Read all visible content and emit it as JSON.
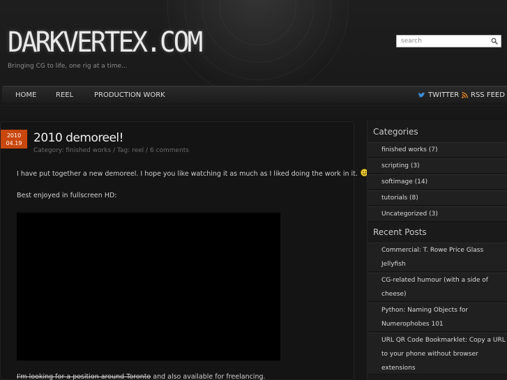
{
  "site": {
    "logo": "DARKVERTEX.COM",
    "tagline": "Bringing CG to life, one rig at a time..."
  },
  "search": {
    "placeholder": "search"
  },
  "nav": {
    "items": [
      "HOME",
      "REEL",
      "PRODUCTION WORK"
    ],
    "twitter": "TWITTER",
    "rss": "RSS FEED"
  },
  "post": {
    "date_year": "2010",
    "date_day": "04.19",
    "title": "2010 demoreel!",
    "meta_prefix": "Category: ",
    "category": "finished works",
    "meta_sep1": " / Tag: ",
    "tag": "reel",
    "meta_sep2": " / ",
    "comments": "6 comments",
    "para1": "I have put together a new demoreel. I hope you like watching it as much as I liked doing the work in it.",
    "para2": "Best enjoyed in fullscreen HD:",
    "para3_strike": "I'm looking for a position around Toronto",
    "para3_rest": " and also available for freelancing."
  },
  "sidebar": {
    "categories_title": "Categories",
    "categories": [
      "finished works (7)",
      "scripting (3)",
      "softimage (14)",
      "tutorials (8)",
      "Uncategorized (3)"
    ],
    "recent_title": "Recent Posts",
    "recent": [
      [
        "Commercial: T. Rowe Price Glass",
        "Jellyfish"
      ],
      [
        "CG-related humour (with a side of",
        "cheese)"
      ],
      [
        "Python: Naming Objects for",
        "Numerophobes 101"
      ],
      [
        "URL QR Code Bookmarklet: Copy a URL",
        "to your phone without browser",
        "extensions"
      ]
    ]
  },
  "colors": {
    "accent": "#c9470d",
    "background": "#161616",
    "twitter_icon": "#3b8fd6",
    "rss_icon": "#e8871e"
  },
  "icons": {
    "search": "magnifier-icon",
    "twitter": "twitter-bird-icon",
    "rss": "rss-icon",
    "smiley": "smiley-icon"
  }
}
